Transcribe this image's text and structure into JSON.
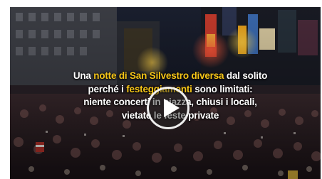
{
  "video": {
    "caption": {
      "line1": {
        "t1": "Una ",
        "h1": "notte di San Silvestro",
        "t2": " diversa",
        "t3": " dal solito"
      },
      "line2": {
        "t1": "perché i ",
        "h1": "festeggiamenti",
        "t2": " sono limitati:"
      },
      "line3": {
        "t1": "niente concerti in piazza, chiusi i locali,"
      },
      "line4": {
        "t1": "vietate le feste private"
      }
    },
    "play_button_icon": "play-icon",
    "colors": {
      "accent": "#f5c518",
      "play_ring": "#ffffff"
    }
  }
}
